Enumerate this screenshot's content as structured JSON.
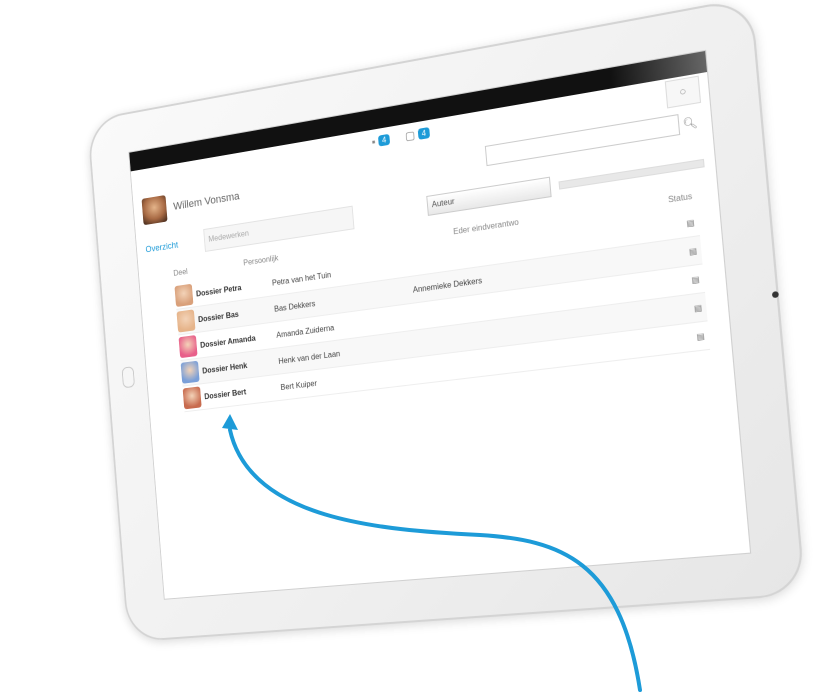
{
  "header": {
    "corner_icon": "○",
    "notifications": [
      {
        "icon": "chat-icon",
        "glyph": "▪",
        "count": "4"
      },
      {
        "icon": "document-icon",
        "glyph": "▢",
        "count": "4"
      }
    ]
  },
  "user": {
    "name": "Willem Vonsma"
  },
  "filters": {
    "tab_label": "Overzicht",
    "select_placeholder": "Medewerken",
    "author_label": "Auteur"
  },
  "table": {
    "headers": {
      "deel": "Deel",
      "person": "Persoonlijk",
      "eindver": "Eder eindverantwo",
      "status": "Status"
    },
    "rows": [
      {
        "dossier": "Dossier Petra",
        "person": "Petra van het Tuin",
        "eind": "",
        "face": "#d9a07a"
      },
      {
        "dossier": "Dossier Bas",
        "person": "Bas Dekkers",
        "eind": "Annemieke Dekkers",
        "face": "#e6b48a"
      },
      {
        "dossier": "Dossier Amanda",
        "person": "Amanda Zuiderna",
        "eind": "",
        "face": "#e85f8a"
      },
      {
        "dossier": "Dossier Henk",
        "person": "Henk van der Laan",
        "eind": "",
        "face": "#7a9fd8"
      },
      {
        "dossier": "Dossier Bert",
        "person": "Bert Kuiper",
        "eind": "",
        "face": "#c86b4e"
      }
    ],
    "status_glyph": "▤"
  },
  "colors": {
    "accent": "#1d9bd8"
  }
}
